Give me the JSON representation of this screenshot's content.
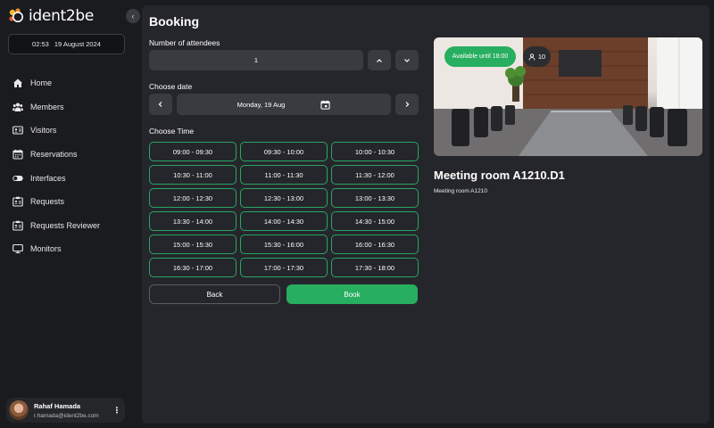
{
  "app": {
    "logo_text": "ident2be"
  },
  "datetime": {
    "time": "02:53",
    "date": "19 August 2024"
  },
  "sidebar": {
    "items": [
      {
        "label": "Home",
        "icon": "home-icon"
      },
      {
        "label": "Members",
        "icon": "members-icon"
      },
      {
        "label": "Visitors",
        "icon": "visitors-icon"
      },
      {
        "label": "Reservations",
        "icon": "calendar-icon"
      },
      {
        "label": "Interfaces",
        "icon": "toggle-icon"
      },
      {
        "label": "Requests",
        "icon": "request-icon"
      },
      {
        "label": "Requests Reviewer",
        "icon": "request-reviewer-icon"
      },
      {
        "label": "Monitors",
        "icon": "monitor-icon"
      }
    ]
  },
  "user": {
    "name": "Rahaf Hamada",
    "email": "r.hamada@ident2be.com"
  },
  "booking": {
    "title": "Booking",
    "attendees_label": "Number of attendees",
    "attendees_value": "1",
    "date_label": "Choose date",
    "date_value": "Monday, 19 Aug",
    "time_label": "Choose Time",
    "time_slots": [
      "09:00 - 09:30",
      "09:30 - 10:00",
      "10:00 - 10:30",
      "10:30 - 11:00",
      "11:00 - 11:30",
      "11:30 - 12:00",
      "12:00 - 12:30",
      "12:30 - 13:00",
      "13:00 - 13:30",
      "13:30 - 14:00",
      "14:00 - 14:30",
      "14:30 - 15:00",
      "15:00 - 15:30",
      "15:30 - 16:00",
      "16:00 - 16:30",
      "16:30 - 17:00",
      "17:00 - 17:30",
      "17:30 - 18:00"
    ],
    "back_label": "Back",
    "book_label": "Book"
  },
  "room": {
    "availability": "Available until 18:00",
    "capacity": "10",
    "name": "Meeting room A1210.D1",
    "subtitle": "Meeting room A1210"
  },
  "colors": {
    "accent": "#27ae60",
    "slot_border": "#2aa564",
    "panel": "#25262b",
    "background": "#1a1b1e",
    "field": "#3a3b40"
  }
}
